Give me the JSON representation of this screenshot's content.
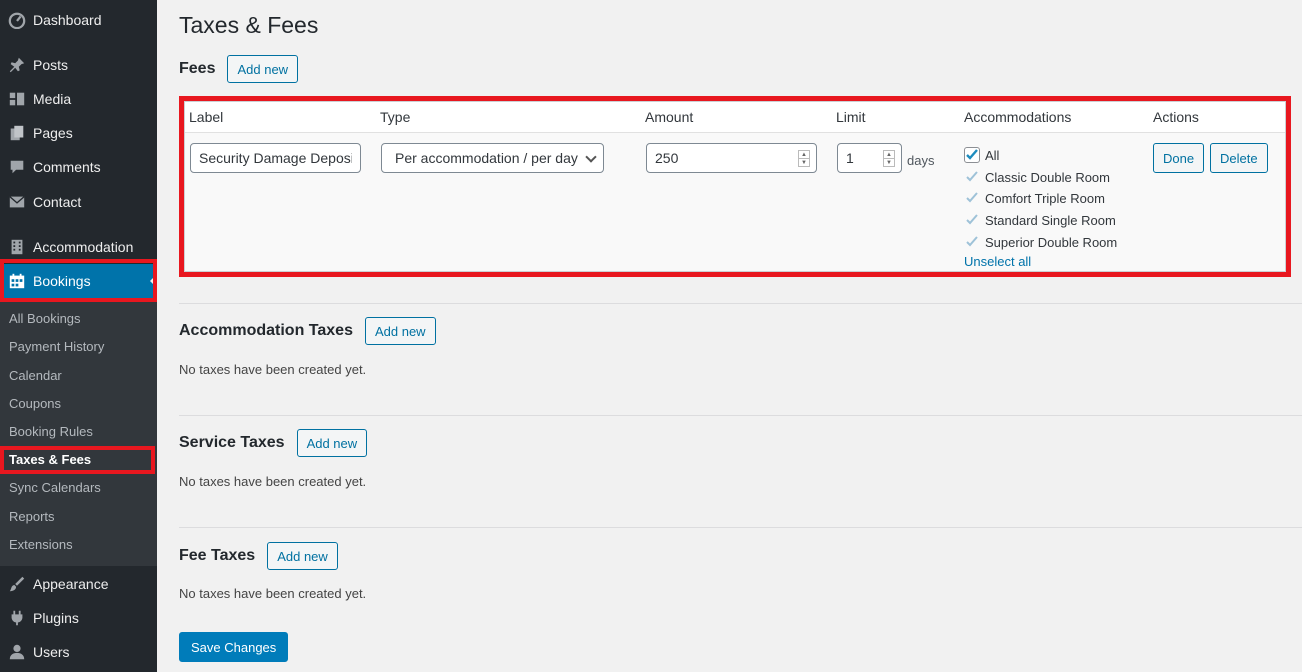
{
  "sidebar": {
    "items": [
      {
        "label": "Dashboard",
        "icon": "dashboard-icon"
      },
      {
        "label": "Posts",
        "icon": "pushpin-icon"
      },
      {
        "label": "Media",
        "icon": "media-icon"
      },
      {
        "label": "Pages",
        "icon": "pages-icon"
      },
      {
        "label": "Comments",
        "icon": "comment-bubble-icon"
      },
      {
        "label": "Contact",
        "icon": "envelope-icon"
      },
      {
        "label": "Accommodation",
        "icon": "building-icon"
      },
      {
        "label": "Bookings",
        "icon": "calendar-icon"
      },
      {
        "label": "Appearance",
        "icon": "paintbrush-icon"
      },
      {
        "label": "Plugins",
        "icon": "plug-icon"
      },
      {
        "label": "Users",
        "icon": "user-icon"
      }
    ],
    "submenu": [
      "All Bookings",
      "Payment History",
      "Calendar",
      "Coupons",
      "Booking Rules",
      "Taxes & Fees",
      "Sync Calendars",
      "Reports",
      "Extensions"
    ]
  },
  "page": {
    "title": "Taxes & Fees",
    "add_new": "Add new",
    "save_changes": "Save Changes"
  },
  "fees": {
    "heading": "Fees",
    "columns": [
      "Label",
      "Type",
      "Amount",
      "Limit",
      "Accommodations",
      "Actions"
    ],
    "row": {
      "label": "Security Damage Deposit",
      "type": "Per accommodation / per day",
      "amount": "250",
      "limit": "1",
      "limit_unit": "days",
      "all_label": "All",
      "accommodations": [
        "Classic Double Room",
        "Comfort Triple Room",
        "Standard Single Room",
        "Superior Double Room"
      ],
      "unselect_all": "Unselect all",
      "done": "Done",
      "delete": "Delete"
    }
  },
  "sections": [
    {
      "heading": "Accommodation Taxes",
      "empty": "No taxes have been created yet."
    },
    {
      "heading": "Service Taxes",
      "empty": "No taxes have been created yet."
    },
    {
      "heading": "Fee Taxes",
      "empty": "No taxes have been created yet."
    }
  ],
  "colors": {
    "sidebar_bg": "#23282d",
    "active_blue": "#0073aa",
    "highlight_red": "#e8171f",
    "primary_button": "#007cba"
  }
}
